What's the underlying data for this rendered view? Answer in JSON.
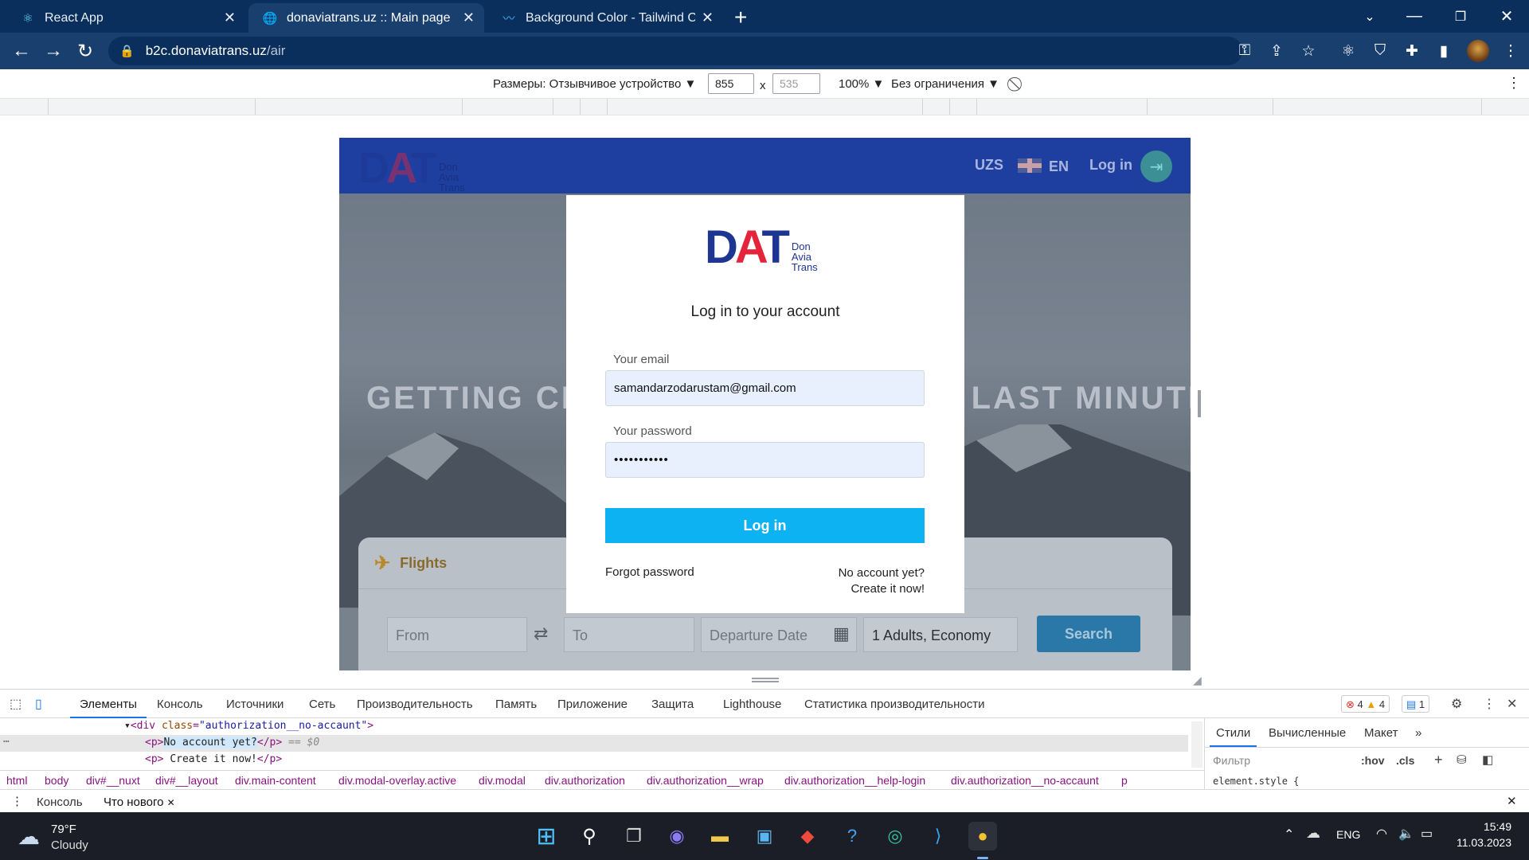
{
  "browser": {
    "tabs": [
      {
        "title": "React App",
        "icon": "react-icon"
      },
      {
        "title": "donaviatrans.uz :: Main page",
        "icon": "globe-icon"
      },
      {
        "title": "Background Color - Tailwind CSS",
        "icon": "tailwind-icon"
      }
    ],
    "url_host": "b2c.donaviatrans.uz",
    "url_path": "/air"
  },
  "device_toolbar": {
    "dimensions_label": "Размеры: Отзывчивое устройство",
    "width": "855",
    "height_placeholder": "535",
    "times": "x",
    "zoom": "100%",
    "throttle": "Без ограничения"
  },
  "site": {
    "header": {
      "currency": "UZS",
      "language": "EN",
      "login": "Log in"
    },
    "logo": {
      "letters": [
        "D",
        "A",
        "T"
      ],
      "sub": [
        "Don",
        "Avia",
        "Trans"
      ]
    },
    "hero_title": "GETTING CHEAP TICKETS AT THE LAST MINUTE",
    "search": {
      "tab": "Flights",
      "from_placeholder": "From",
      "to_placeholder": "To",
      "date_placeholder": "Departure Date",
      "passengers": "1 Adults, Economy",
      "button": "Search"
    },
    "modal": {
      "title": "Log in to your account",
      "email_label": "Your email",
      "email_value": "samandarzodarustam@gmail.com",
      "password_label": "Your password",
      "password_value": "•••••••••••",
      "submit": "Log in",
      "forgot": "Forgot password",
      "no_account": "No account yet?",
      "create": "Create it now!"
    }
  },
  "devtools": {
    "tabs": [
      "Элементы",
      "Консоль",
      "Источники",
      "Сеть",
      "Производительность",
      "Память",
      "Приложение",
      "Защита",
      "Lighthouse",
      "Статистика производительности"
    ],
    "errors": "4",
    "warnings": "4",
    "messages": "1",
    "code": {
      "line1_tag": "div",
      "line1_attr": "class",
      "line1_val": "\"authorization__no-accaunt\"",
      "line2_text": "No account yet?",
      "line2_suffix": "== $0",
      "line3_text": "Create it now!"
    },
    "breadcrumbs": [
      "html",
      "body",
      "div#__nuxt",
      "div#__layout",
      "div.main-content",
      "div.modal-overlay.active",
      "div.modal",
      "div.authorization",
      "div.authorization__wrap",
      "div.authorization__help-login",
      "div.authorization__no-accaunt",
      "p"
    ],
    "side_tabs": [
      "Стили",
      "Вычисленные",
      "Макет"
    ],
    "filter_placeholder": "Фильтр",
    "hov": ":hov",
    "cls": ".cls",
    "element_style": "element.style {",
    "drawer_tabs": [
      "Консоль",
      "Что нового"
    ]
  },
  "taskbar": {
    "weather_temp": "79°F",
    "weather_desc": "Cloudy",
    "lang": "ENG",
    "time": "15:49",
    "date": "11.03.2023"
  },
  "colors": {
    "site_header": "#1e3fa0",
    "login_button": "#0db2f2",
    "logo_red": "#e3243b",
    "logo_blue": "#1e3592"
  }
}
